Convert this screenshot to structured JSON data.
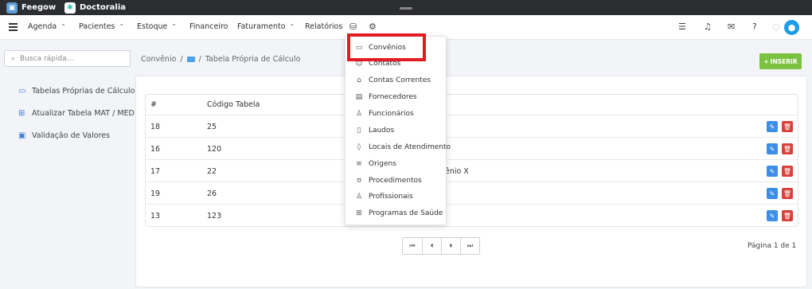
{
  "app_tabs": [
    {
      "label": "Feegow"
    },
    {
      "label": "Doctoralia"
    }
  ],
  "nav": {
    "items": [
      {
        "label": "Agenda",
        "caret": "⌃"
      },
      {
        "label": "Pacientes",
        "caret": "⌃"
      },
      {
        "label": "Estoque",
        "caret": "⌃"
      },
      {
        "label": "Financeiro"
      },
      {
        "label": "Faturamento",
        "caret": "⌃"
      },
      {
        "label": "Relatórios"
      }
    ],
    "avatar_icon": "user-icon"
  },
  "sidebar": {
    "search_placeholder": "Busca rápida...",
    "items": [
      {
        "label": "Tabelas Próprias de Cálculo",
        "icon": "card-icon"
      },
      {
        "label": "Atualizar Tabela MAT / MED",
        "icon": "grid-icon"
      },
      {
        "label": "Validação de Valores",
        "icon": "money-icon"
      }
    ]
  },
  "breadcrumb": {
    "root": "Convênio",
    "sep1": "/",
    "sep2": "/",
    "current": "Tabela Própria de Cálculo"
  },
  "insert_button": {
    "label": "INSERIR"
  },
  "table": {
    "headers": [
      "#",
      "Código Tabela"
    ],
    "rows": [
      {
        "id": "18",
        "code": "25",
        "extra": ""
      },
      {
        "id": "16",
        "code": "120",
        "extra": ""
      },
      {
        "id": "17",
        "code": "22",
        "extra": "ênio X"
      },
      {
        "id": "19",
        "code": "26",
        "extra": ""
      },
      {
        "id": "13",
        "code": "123",
        "extra": ""
      }
    ]
  },
  "pagination": {
    "first": "⏮",
    "prev": "⏴",
    "next": "⏵",
    "last": "⏭",
    "info": "Página 1 de 1"
  },
  "dropdown": {
    "items": [
      {
        "label": "Convênios",
        "icon": "card-icon"
      },
      {
        "label": "Contatos",
        "icon": "contacts-icon"
      },
      {
        "label": "Contas Correntes",
        "icon": "bank-icon"
      },
      {
        "label": "Fornecedores",
        "icon": "box-icon"
      },
      {
        "label": "Funcionários",
        "icon": "user-icon"
      },
      {
        "label": "Laudos",
        "icon": "file-icon"
      },
      {
        "label": "Locais de Atendimento",
        "icon": "location-icon"
      },
      {
        "label": "Origens",
        "icon": "list-icon"
      },
      {
        "label": "Procedimentos",
        "icon": "stethoscope-icon"
      },
      {
        "label": "Profissionais",
        "icon": "doctor-icon"
      },
      {
        "label": "Programas de Saúde",
        "icon": "health-kit-icon"
      }
    ]
  },
  "colors": {
    "accent": "#3d7dd6",
    "insert": "#7cc242",
    "delete": "#d9413a",
    "edit": "#3d8ee6",
    "highlight": "#e31b23",
    "avatar": "#1e9be9"
  }
}
